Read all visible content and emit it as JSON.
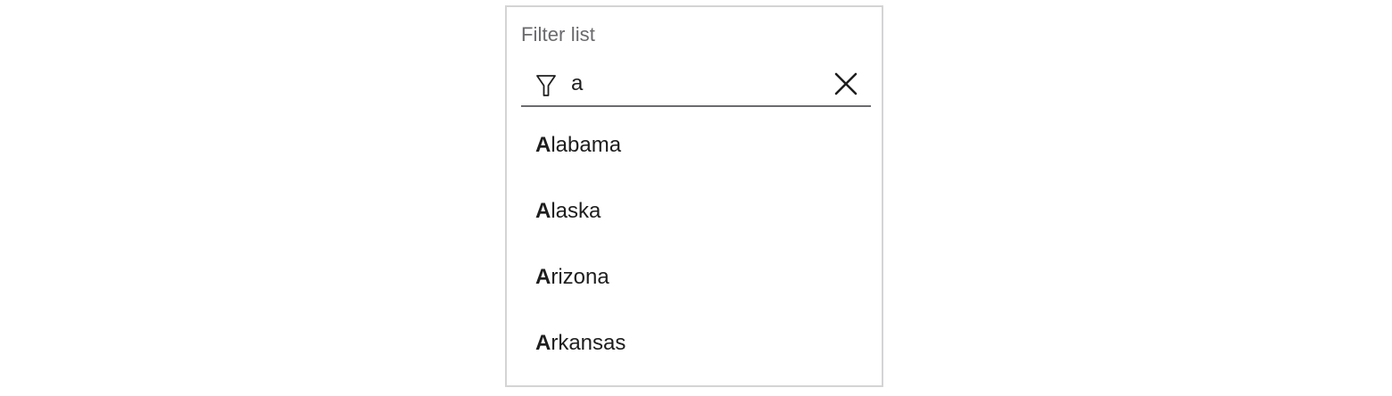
{
  "filter": {
    "label": "Filter list",
    "value": "a",
    "filter_icon": "filter-icon",
    "clear_icon": "close-icon"
  },
  "results": [
    {
      "match": "A",
      "rest": "labama"
    },
    {
      "match": "A",
      "rest": "laska"
    },
    {
      "match": "A",
      "rest": "rizona"
    },
    {
      "match": "A",
      "rest": "rkansas"
    }
  ],
  "colors": {
    "border": "#d4d4d6",
    "underline": "#6b6b70",
    "label": "#6a6a6e",
    "text": "#1e1e1e"
  }
}
